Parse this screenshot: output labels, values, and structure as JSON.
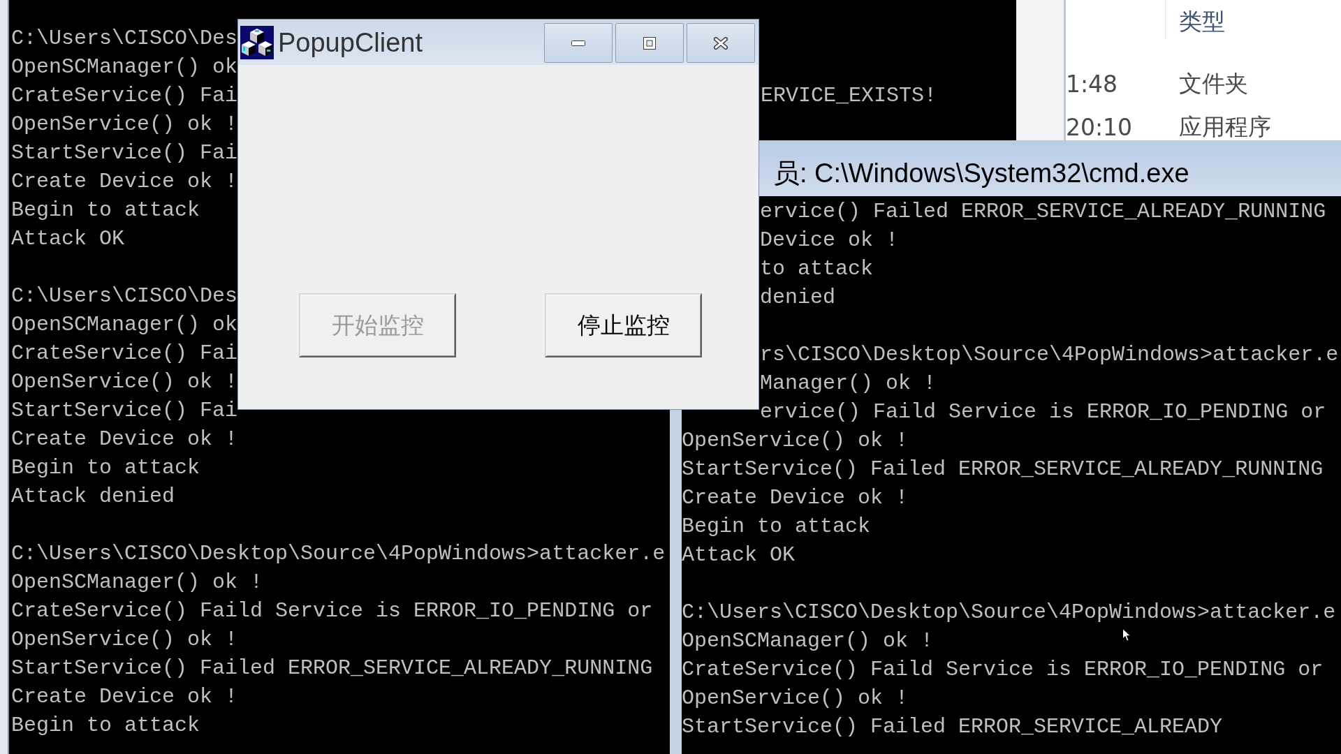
{
  "left_console": {
    "blocks": [
      {
        "lines": [
          {
            "text": "C:\\Users\\CISCO\\Des"
          },
          {
            "text": "OpenSCManager() ok"
          },
          {
            "text": "CrateService() Fai",
            "text_right_of_popup": "ERVICE_EXISTS!"
          },
          {
            "text": "OpenService() ok !"
          },
          {
            "text": "StartService() Fai"
          },
          {
            "text": "Create Device ok !"
          },
          {
            "text": "Begin to attack"
          },
          {
            "text": "Attack OK"
          }
        ]
      },
      {
        "lines": [
          {
            "text": "C:\\Users\\CISCO\\Des"
          },
          {
            "text": "OpenSCManager() ok"
          },
          {
            "text": "CrateService() Fai"
          },
          {
            "text": "OpenService() ok !"
          },
          {
            "text": "StartService() Fai"
          },
          {
            "text": "Create Device ok !"
          },
          {
            "text": "Begin to attack"
          },
          {
            "text": "Attack denied"
          }
        ]
      },
      {
        "lines": [
          {
            "text": "C:\\Users\\CISCO\\Desktop\\Source\\4PopWindows>attacker.e"
          },
          {
            "text": "OpenSCManager() ok !"
          },
          {
            "text": "CrateService() Faild Service is ERROR_IO_PENDING or"
          },
          {
            "text": "OpenService() ok !"
          },
          {
            "text": "StartService() Failed ERROR_SERVICE_ALREADY_RUNNING"
          },
          {
            "text": "Create Device ok !"
          },
          {
            "text": "Begin to attack"
          }
        ]
      }
    ]
  },
  "popup_window": {
    "title": "PopupClient",
    "buttons": [
      {
        "label": "开始监控",
        "disabled": true
      },
      {
        "label": "停止监控",
        "disabled": false
      }
    ]
  },
  "explorer": {
    "type_header": "类型",
    "rows": [
      {
        "column_1": "1:48",
        "type": "文件夹"
      },
      {
        "column_1": "20:10",
        "type": "应用程序"
      }
    ]
  },
  "right_console": {
    "title": "员: C:\\Windows\\System32\\cmd.exe",
    "blocks": [
      {
        "lines": [
          {
            "text": "ervice() Failed ERROR_SERVICE_ALREADY_RUNNING",
            "behind_popup": true
          },
          {
            "text": "Device ok !",
            "behind_popup": true
          },
          {
            "text": "to attack",
            "behind_popup": true
          },
          {
            "text": "denied",
            "behind_popup": true
          }
        ]
      },
      {
        "lines": [
          {
            "text": "rs\\CISCO\\Desktop\\Source\\4PopWindows>attacker.e",
            "behind_popup": true
          },
          {
            "text": "Manager() ok !",
            "behind_popup": true
          },
          {
            "text": "ervice() Faild Service is ERROR_IO_PENDING or",
            "behind_popup": true
          },
          {
            "text": "OpenService() ok !",
            "behind_popup": false
          },
          {
            "text": "StartService() Failed ERROR_SERVICE_ALREADY_RUNNING",
            "behind_popup": false
          },
          {
            "text": "Create Device ok !",
            "behind_popup": false
          },
          {
            "text": "Begin to attack",
            "behind_popup": false
          },
          {
            "text": "Attack OK",
            "behind_popup": false
          }
        ]
      },
      {
        "lines": [
          {
            "text": "C:\\Users\\CISCO\\Desktop\\Source\\4PopWindows>attacker.e",
            "behind_popup": false
          },
          {
            "text": "OpenSCManager() ok !",
            "behind_popup": false
          },
          {
            "text": "CrateService() Faild Service is ERROR_IO_PENDING or",
            "behind_popup": false
          },
          {
            "text": "OpenService() ok !",
            "behind_popup": false
          },
          {
            "text": "StartService() Failed ERROR_SERVICE_ALREADY",
            "behind_popup": false
          }
        ]
      }
    ]
  }
}
